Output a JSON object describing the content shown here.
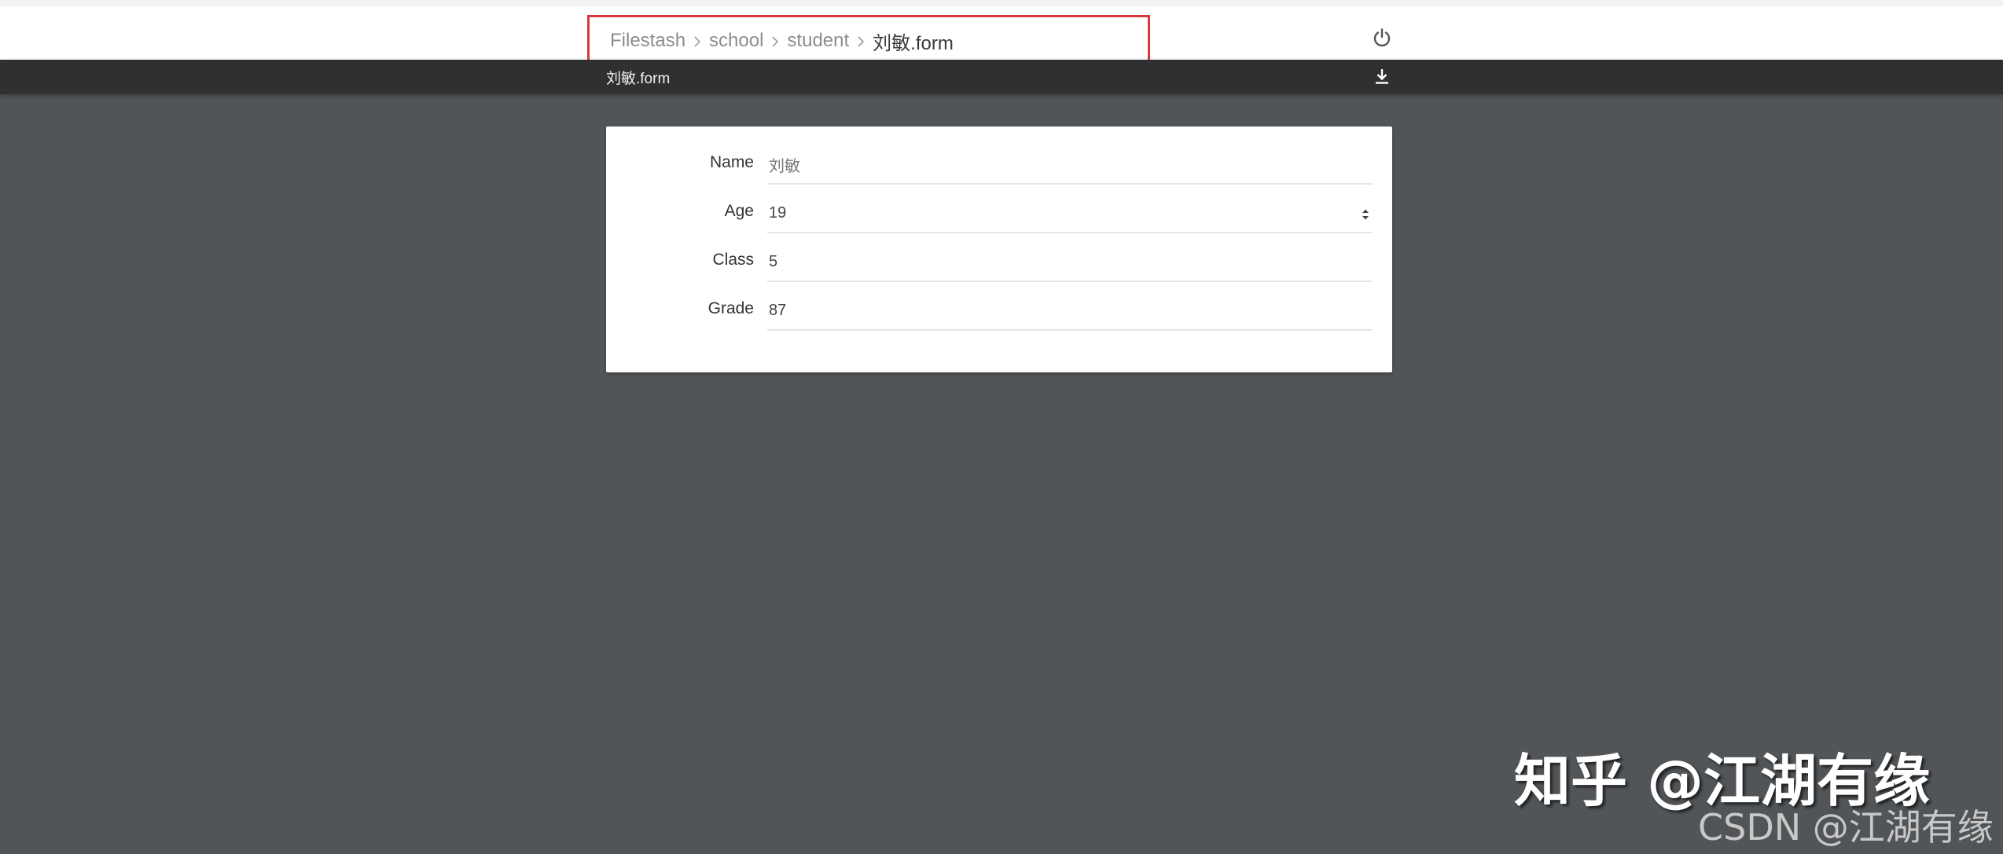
{
  "breadcrumb": {
    "items": [
      {
        "label": "Filestash"
      },
      {
        "label": "school"
      },
      {
        "label": "student"
      },
      {
        "label": "刘敏.form"
      }
    ]
  },
  "header": {
    "power_icon": "power-icon"
  },
  "subbar": {
    "title": "刘敏.form",
    "download_icon": "download-icon"
  },
  "form": {
    "fields": [
      {
        "label": "Name",
        "value": "刘敏",
        "type": "text"
      },
      {
        "label": "Age",
        "value": "19",
        "type": "number"
      },
      {
        "label": "Class",
        "value": "5",
        "type": "text"
      },
      {
        "label": "Grade",
        "value": "87",
        "type": "text"
      }
    ]
  },
  "watermarks": {
    "zhihu": "知乎 @江湖有缘",
    "csdn": "CSDN @江湖有缘"
  },
  "colors": {
    "background": "#525558",
    "subbar": "#2e3032",
    "highlight": "#d9373e"
  }
}
